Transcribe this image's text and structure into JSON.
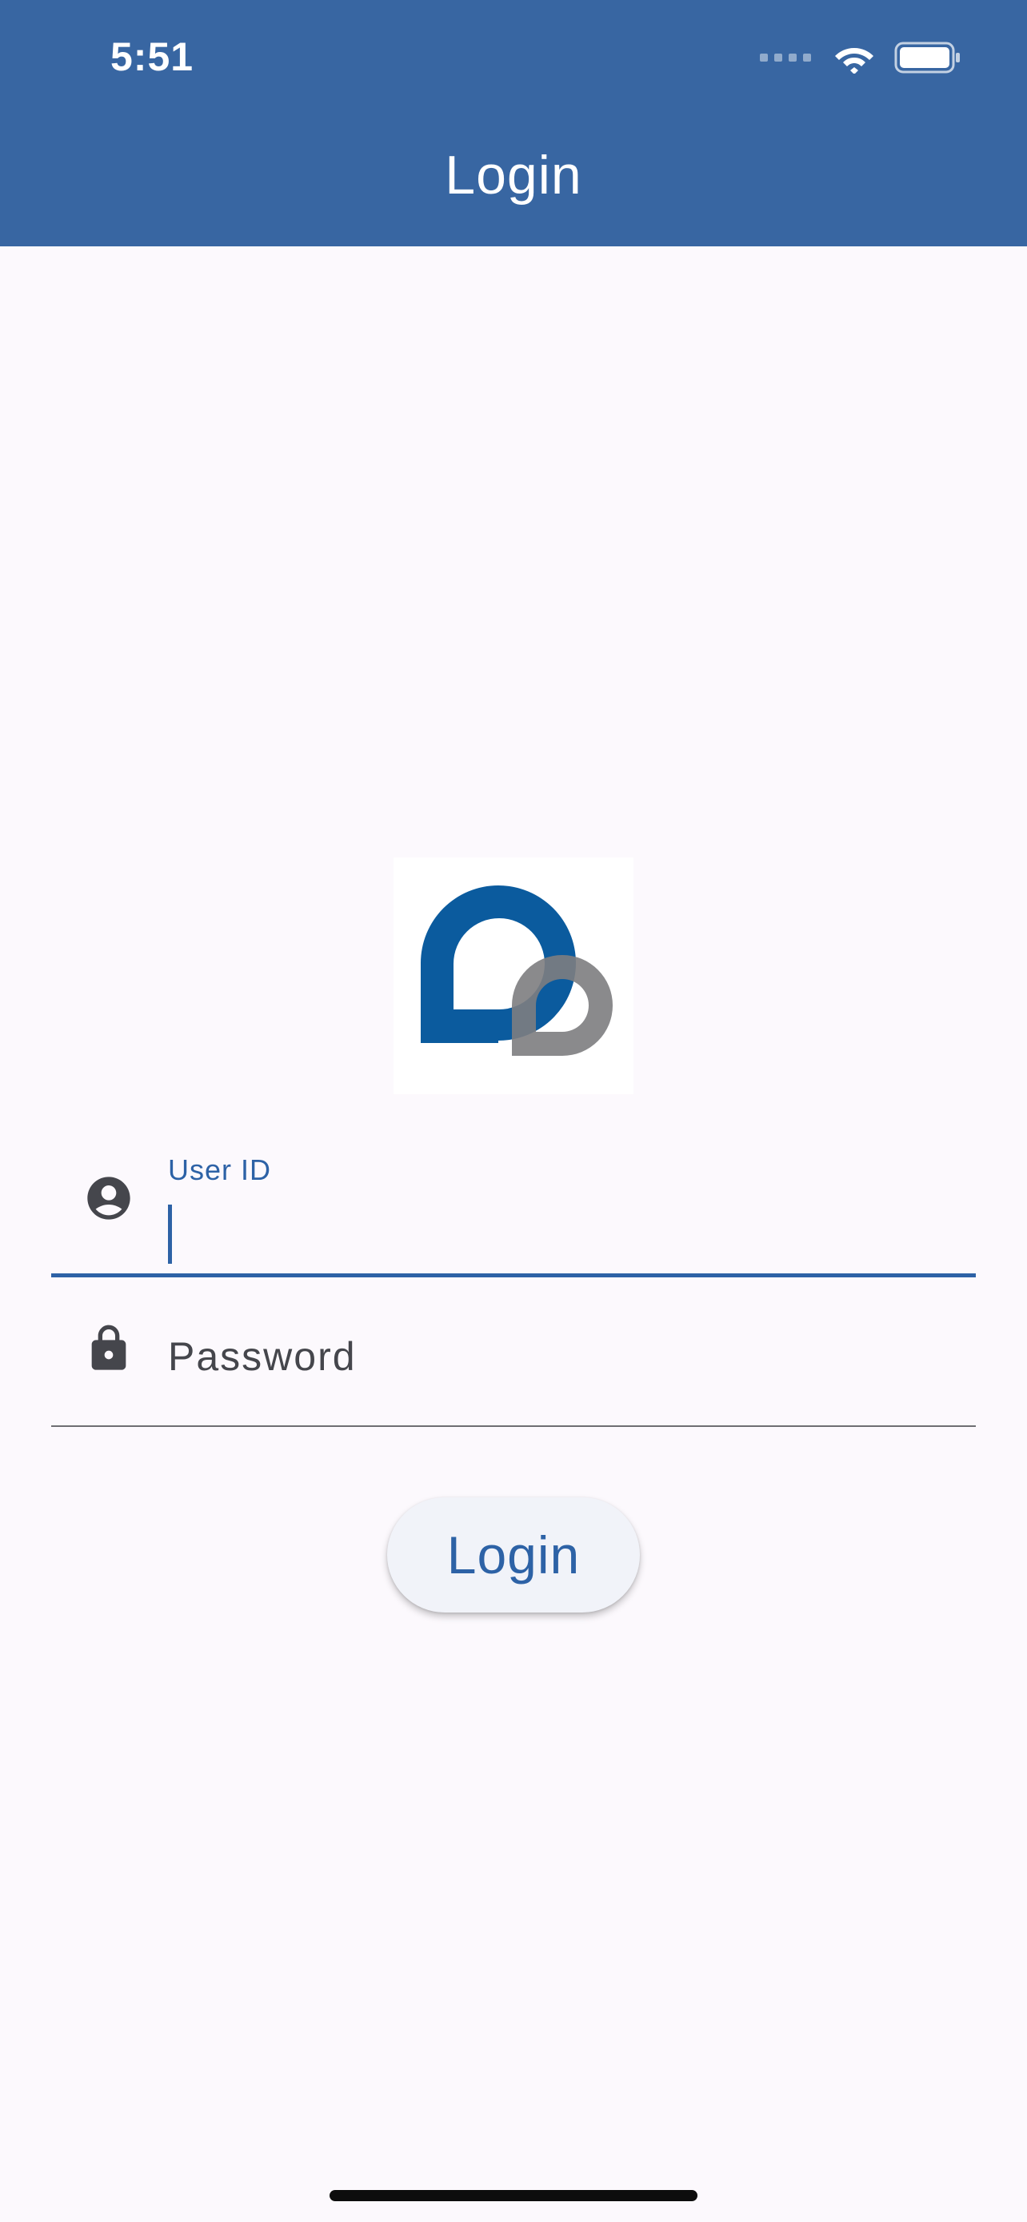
{
  "status_bar": {
    "time": "5:51",
    "icons": [
      "cellular-signal-icon",
      "wifi-icon",
      "battery-icon"
    ]
  },
  "header": {
    "title": "Login"
  },
  "logo": {
    "name": "app-logo",
    "colors": {
      "primary": "#0b5b9e",
      "secondary": "#8a8a8e"
    }
  },
  "form": {
    "user_id": {
      "label": "User ID",
      "value": "",
      "icon": "account-circle-icon"
    },
    "password": {
      "placeholder": "Password",
      "value": "",
      "icon": "lock-icon"
    },
    "submit_label": "Login"
  },
  "colors": {
    "header_bg": "#3866a2",
    "accent": "#2d62a6",
    "background": "#fcf9fd",
    "button_bg": "#f1f3f9",
    "icon": "#45464c"
  }
}
